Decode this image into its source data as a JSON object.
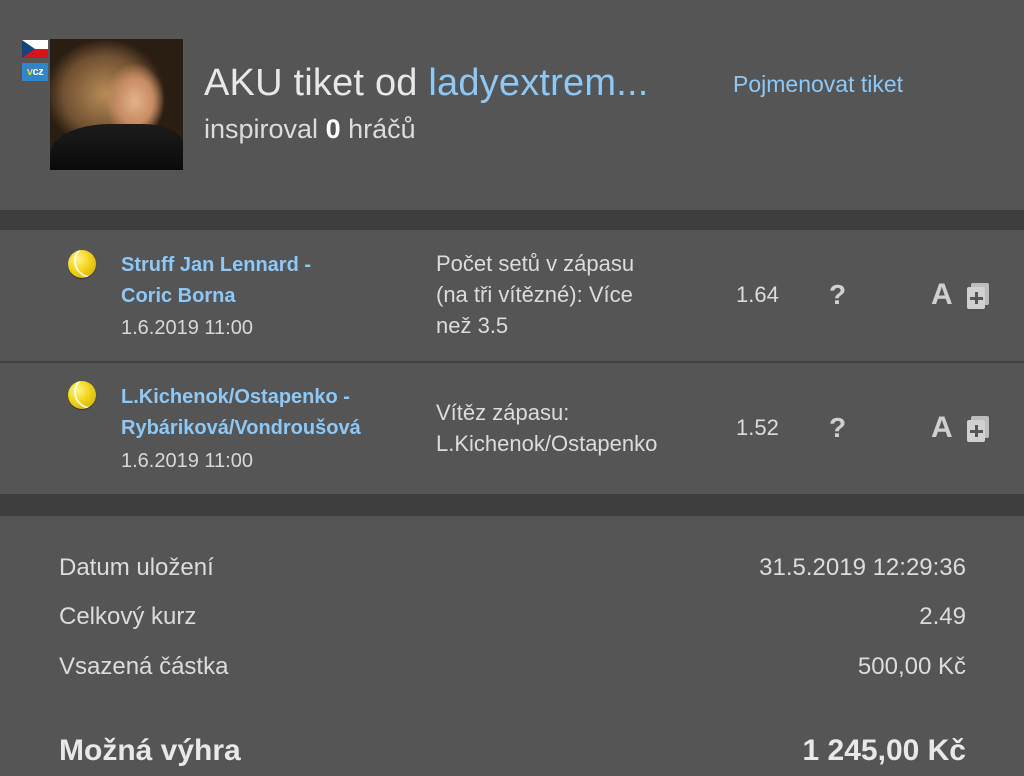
{
  "header": {
    "title_prefix": "AKU tiket od",
    "username": "ladyextrem...",
    "rename_link": "Pojmenovat tiket",
    "inspired_prefix": "inspiroval",
    "inspired_count": "0",
    "inspired_suffix": "hráčů",
    "badge_text": "cz",
    "badge_v": "v"
  },
  "bets": [
    {
      "match": "Struff Jan Lennard - Coric Borna",
      "match_line1": "Struff Jan Lennard -",
      "match_line2": "Coric Borna",
      "date": "1.6.2019 11:00",
      "market_line1": "Počet setů v zápasu",
      "market_line2": "(na tři vítězné): Více",
      "market_line3": "než 3.5",
      "odds": "1.64",
      "help": "?",
      "a_label": "A"
    },
    {
      "match": "L.Kichenok/Ostapenko - Rybáriková/Vondroušová",
      "match_line1": "L.Kichenok/Ostapenko -",
      "match_line2": "Rybáriková/Vondroušová",
      "date": "1.6.2019 11:00",
      "market_line1": "Vítěz zápasu:",
      "market_line2": "L.Kichenok/Ostapenko",
      "odds": "1.52",
      "help": "?",
      "a_label": "A"
    }
  ],
  "summary": {
    "saved_label": "Datum uložení",
    "saved_value": "31.5.2019 12:29:36",
    "total_odds_label": "Celkový kurz",
    "total_odds_value": "2.49",
    "stake_label": "Vsazená částka",
    "stake_value": "500,00 Kč",
    "win_label": "Možná výhra",
    "win_value": "1 245,00 Kč"
  },
  "icons": {
    "sport": "tennis-ball-icon",
    "help": "question-mark-icon",
    "analysis": "letter-a-icon",
    "add": "add-to-ticket-icon"
  }
}
